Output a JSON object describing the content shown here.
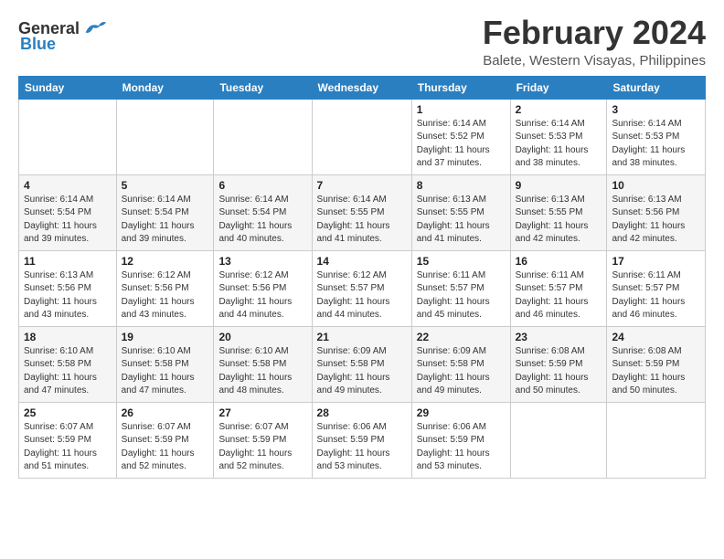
{
  "app": {
    "name": "GeneralBlue",
    "logo_text_general": "General",
    "logo_text_blue": "Blue"
  },
  "header": {
    "month": "February 2024",
    "location": "Balete, Western Visayas, Philippines"
  },
  "weekdays": [
    "Sunday",
    "Monday",
    "Tuesday",
    "Wednesday",
    "Thursday",
    "Friday",
    "Saturday"
  ],
  "weeks": [
    [
      {
        "day": "",
        "info": ""
      },
      {
        "day": "",
        "info": ""
      },
      {
        "day": "",
        "info": ""
      },
      {
        "day": "",
        "info": ""
      },
      {
        "day": "1",
        "info": "Sunrise: 6:14 AM\nSunset: 5:52 PM\nDaylight: 11 hours\nand 37 minutes."
      },
      {
        "day": "2",
        "info": "Sunrise: 6:14 AM\nSunset: 5:53 PM\nDaylight: 11 hours\nand 38 minutes."
      },
      {
        "day": "3",
        "info": "Sunrise: 6:14 AM\nSunset: 5:53 PM\nDaylight: 11 hours\nand 38 minutes."
      }
    ],
    [
      {
        "day": "4",
        "info": "Sunrise: 6:14 AM\nSunset: 5:54 PM\nDaylight: 11 hours\nand 39 minutes."
      },
      {
        "day": "5",
        "info": "Sunrise: 6:14 AM\nSunset: 5:54 PM\nDaylight: 11 hours\nand 39 minutes."
      },
      {
        "day": "6",
        "info": "Sunrise: 6:14 AM\nSunset: 5:54 PM\nDaylight: 11 hours\nand 40 minutes."
      },
      {
        "day": "7",
        "info": "Sunrise: 6:14 AM\nSunset: 5:55 PM\nDaylight: 11 hours\nand 41 minutes."
      },
      {
        "day": "8",
        "info": "Sunrise: 6:13 AM\nSunset: 5:55 PM\nDaylight: 11 hours\nand 41 minutes."
      },
      {
        "day": "9",
        "info": "Sunrise: 6:13 AM\nSunset: 5:55 PM\nDaylight: 11 hours\nand 42 minutes."
      },
      {
        "day": "10",
        "info": "Sunrise: 6:13 AM\nSunset: 5:56 PM\nDaylight: 11 hours\nand 42 minutes."
      }
    ],
    [
      {
        "day": "11",
        "info": "Sunrise: 6:13 AM\nSunset: 5:56 PM\nDaylight: 11 hours\nand 43 minutes."
      },
      {
        "day": "12",
        "info": "Sunrise: 6:12 AM\nSunset: 5:56 PM\nDaylight: 11 hours\nand 43 minutes."
      },
      {
        "day": "13",
        "info": "Sunrise: 6:12 AM\nSunset: 5:56 PM\nDaylight: 11 hours\nand 44 minutes."
      },
      {
        "day": "14",
        "info": "Sunrise: 6:12 AM\nSunset: 5:57 PM\nDaylight: 11 hours\nand 44 minutes."
      },
      {
        "day": "15",
        "info": "Sunrise: 6:11 AM\nSunset: 5:57 PM\nDaylight: 11 hours\nand 45 minutes."
      },
      {
        "day": "16",
        "info": "Sunrise: 6:11 AM\nSunset: 5:57 PM\nDaylight: 11 hours\nand 46 minutes."
      },
      {
        "day": "17",
        "info": "Sunrise: 6:11 AM\nSunset: 5:57 PM\nDaylight: 11 hours\nand 46 minutes."
      }
    ],
    [
      {
        "day": "18",
        "info": "Sunrise: 6:10 AM\nSunset: 5:58 PM\nDaylight: 11 hours\nand 47 minutes."
      },
      {
        "day": "19",
        "info": "Sunrise: 6:10 AM\nSunset: 5:58 PM\nDaylight: 11 hours\nand 47 minutes."
      },
      {
        "day": "20",
        "info": "Sunrise: 6:10 AM\nSunset: 5:58 PM\nDaylight: 11 hours\nand 48 minutes."
      },
      {
        "day": "21",
        "info": "Sunrise: 6:09 AM\nSunset: 5:58 PM\nDaylight: 11 hours\nand 49 minutes."
      },
      {
        "day": "22",
        "info": "Sunrise: 6:09 AM\nSunset: 5:58 PM\nDaylight: 11 hours\nand 49 minutes."
      },
      {
        "day": "23",
        "info": "Sunrise: 6:08 AM\nSunset: 5:59 PM\nDaylight: 11 hours\nand 50 minutes."
      },
      {
        "day": "24",
        "info": "Sunrise: 6:08 AM\nSunset: 5:59 PM\nDaylight: 11 hours\nand 50 minutes."
      }
    ],
    [
      {
        "day": "25",
        "info": "Sunrise: 6:07 AM\nSunset: 5:59 PM\nDaylight: 11 hours\nand 51 minutes."
      },
      {
        "day": "26",
        "info": "Sunrise: 6:07 AM\nSunset: 5:59 PM\nDaylight: 11 hours\nand 52 minutes."
      },
      {
        "day": "27",
        "info": "Sunrise: 6:07 AM\nSunset: 5:59 PM\nDaylight: 11 hours\nand 52 minutes."
      },
      {
        "day": "28",
        "info": "Sunrise: 6:06 AM\nSunset: 5:59 PM\nDaylight: 11 hours\nand 53 minutes."
      },
      {
        "day": "29",
        "info": "Sunrise: 6:06 AM\nSunset: 5:59 PM\nDaylight: 11 hours\nand 53 minutes."
      },
      {
        "day": "",
        "info": ""
      },
      {
        "day": "",
        "info": ""
      }
    ]
  ]
}
